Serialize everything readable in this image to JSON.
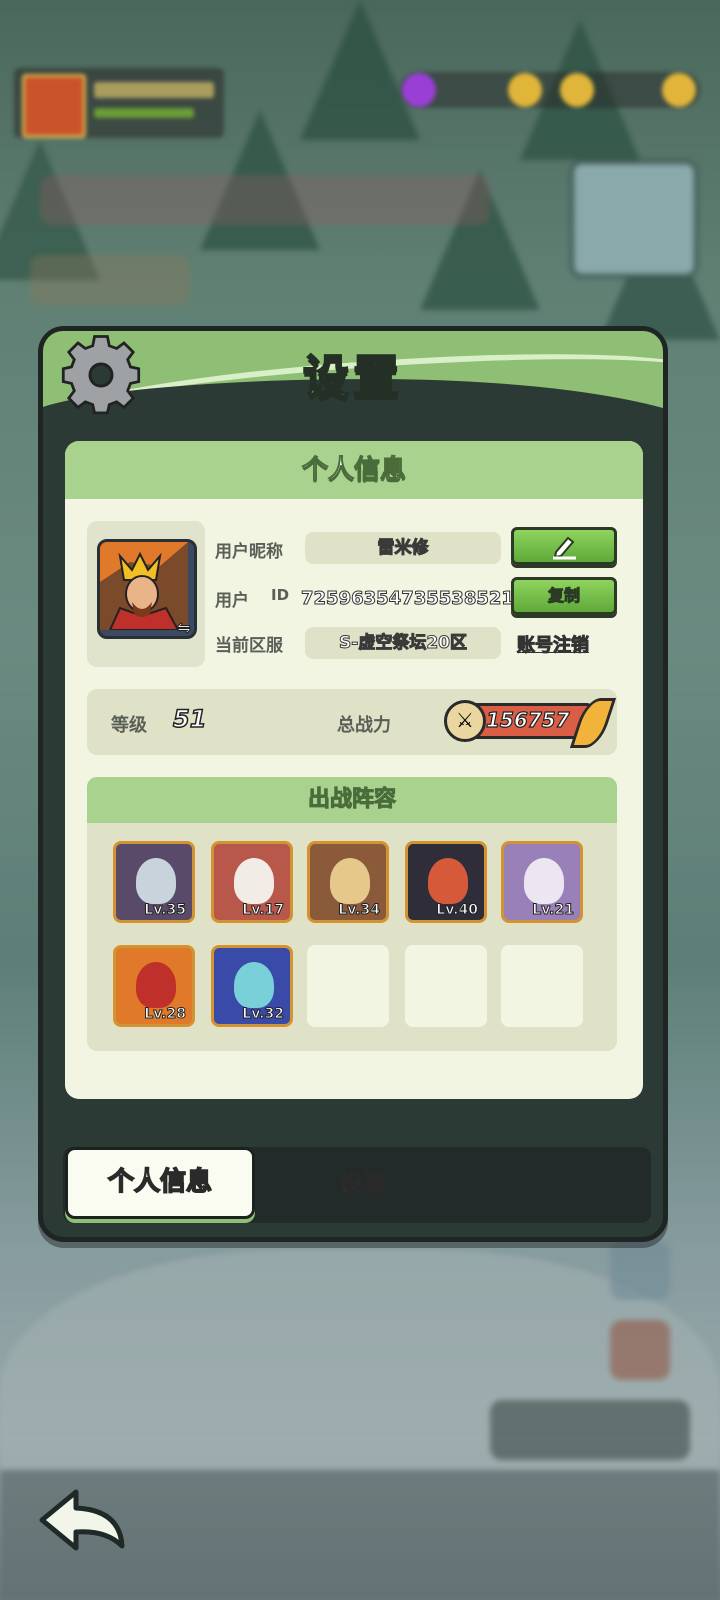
{
  "dialog": {
    "title": "设置",
    "section_title": "个人信息",
    "labels": {
      "nickname": "用户昵称",
      "user": "用户",
      "id": "ID",
      "server": "当前区服"
    },
    "values": {
      "nickname": "雷米修",
      "user_id": "72596354735538521",
      "server": "S-虚空祭坛20区"
    },
    "buttons": {
      "copy": "复制",
      "cancel_account": "账号注销"
    },
    "stats": {
      "level_label": "等级",
      "level": "51",
      "power_label": "总战力",
      "power": "156757"
    },
    "lineup": {
      "title": "出战阵容",
      "heroes": [
        {
          "level": "Lv.35"
        },
        {
          "level": "Lv.17"
        },
        {
          "level": "Lv.34"
        },
        {
          "level": "Lv.40"
        },
        {
          "level": "Lv.21"
        },
        {
          "level": "Lv.28"
        },
        {
          "level": "Lv.32"
        }
      ]
    },
    "tabs": {
      "personal": "个人信息",
      "settings": "设置"
    }
  },
  "colors": {
    "panel": "#2c3a36",
    "header_green": "#8fbf74",
    "button_green": "#5fa93a",
    "hero_border": "#d39330"
  },
  "icons": [
    "gear-icon",
    "edit-icon",
    "swap-icon",
    "sword-icon",
    "back-arrow-icon"
  ]
}
